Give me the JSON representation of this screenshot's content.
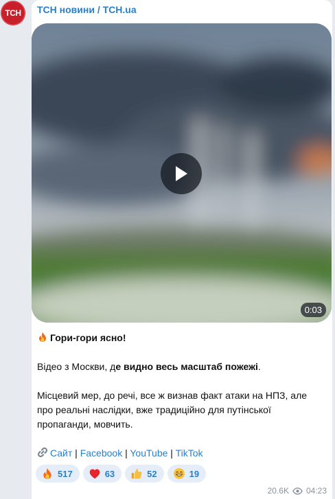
{
  "channel": {
    "avatar_text": "ТСН",
    "name": "ТСН новини / TCH.ua"
  },
  "video": {
    "duration": "0:03"
  },
  "post": {
    "title": "Гори-гори ясно!",
    "line2_prefix": "Відео з Москви, д",
    "line2_bold": "е видно весь масштаб пожежі",
    "line2_suffix": ".",
    "paragraph": "Місцевий мер, до речі, все ж визнав факт атаки на НПЗ, але про реальні наслідки, вже традиційно для путінської пропаганди, мовчить.",
    "links": {
      "site": "Сайт",
      "sep": " | ",
      "facebook": "Facebook",
      "youtube": "YouTube",
      "tiktok": "TikTok"
    }
  },
  "reactions": [
    {
      "icon": "fire-emoji",
      "count": "517"
    },
    {
      "icon": "heart-emoji",
      "count": "63"
    },
    {
      "icon": "thumbs-up-emoji",
      "count": "52"
    },
    {
      "icon": "grin-emoji",
      "count": "19"
    }
  ],
  "meta": {
    "views": "20.6K",
    "time": "04:23"
  },
  "colors": {
    "link": "#2a7fc9",
    "reaction_bg": "#e5eef8",
    "avatar_bg": "#c8202a"
  }
}
